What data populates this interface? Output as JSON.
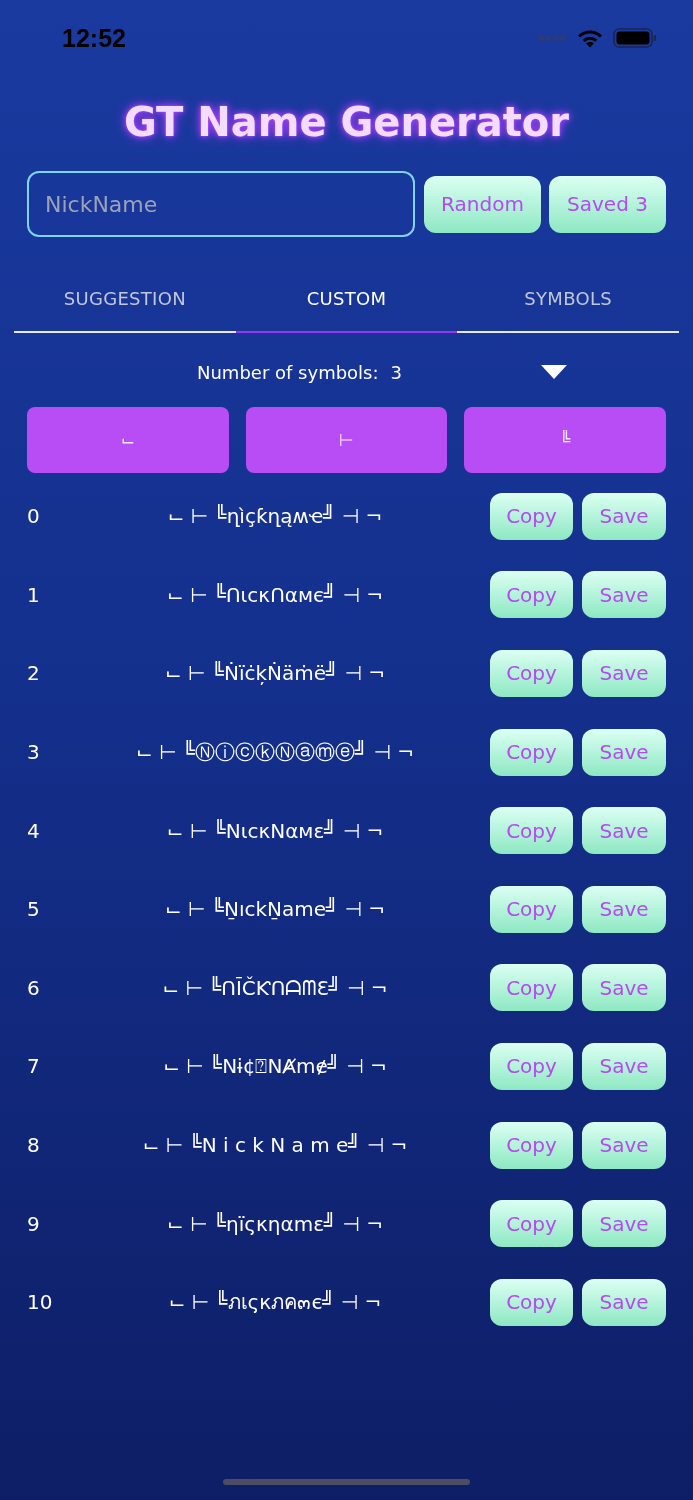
{
  "status_bar": {
    "time": "12:52"
  },
  "title": "GT Name Generator",
  "nickname_field": {
    "placeholder": "NickName"
  },
  "header_buttons": [
    {
      "label": "Random"
    },
    {
      "label": "Saved 3"
    }
  ],
  "tabs": [
    {
      "label": "SUGGESTION",
      "selected": false
    },
    {
      "label": "CUSTOM",
      "selected": true
    },
    {
      "label": "SYMBOLS",
      "selected": false
    }
  ],
  "symbol_count": {
    "label": "Number of symbols:",
    "value": "3"
  },
  "symbol_buttons": [
    "⌙",
    "⊢",
    "╚"
  ],
  "results": [
    {
      "index": "0",
      "name": "⌙ ⊢ ╚ղìçƙղąʍҽ╝ ⊣ ¬",
      "copy": "Copy",
      "save": "Save"
    },
    {
      "index": "1",
      "name": "⌙ ⊢ ╚ՈιcκՈαмє╝ ⊣ ¬",
      "copy": "Copy",
      "save": "Save"
    },
    {
      "index": "2",
      "name": "⌙ ⊢ ╚ṄïċķṄäṁë╝ ⊣ ¬",
      "copy": "Copy",
      "save": "Save"
    },
    {
      "index": "3",
      "name": "⌙ ⊢ ╚ⓃⓘⓒⓚⓃⓐⓜⓔ╝ ⊣ ¬",
      "copy": "Copy",
      "save": "Save"
    },
    {
      "index": "4",
      "name": "⌙ ⊢ ╚NιcκNαмε╝ ⊣ ¬",
      "copy": "Copy",
      "save": "Save"
    },
    {
      "index": "5",
      "name": "⌙ ⊢ ╚ṈıckṈame╝ ⊣ ¬",
      "copy": "Copy",
      "save": "Save"
    },
    {
      "index": "6",
      "name": "⌙ ⊢ ╚ՈĪČƘՈᗩᗰƐ╝ ⊣ ¬",
      "copy": "Copy",
      "save": "Save"
    },
    {
      "index": "7",
      "name": "⌙ ⊢ ╚Nɨ¢⍰NȺmɇ╝ ⊣ ¬",
      "copy": "Copy",
      "save": "Save"
    },
    {
      "index": "8",
      "name": "⌙ ⊢ ╚N i c k N a m e╝ ⊣ ¬",
      "copy": "Copy",
      "save": "Save"
    },
    {
      "index": "9",
      "name": "⌙ ⊢ ╚ηïςκηαmε╝ ⊣ ¬",
      "copy": "Copy",
      "save": "Save"
    },
    {
      "index": "10",
      "name": "⌙ ⊢ ╚ภเςкภค๓є╝ ⊣ ¬",
      "copy": "Copy",
      "save": "Save"
    }
  ]
}
